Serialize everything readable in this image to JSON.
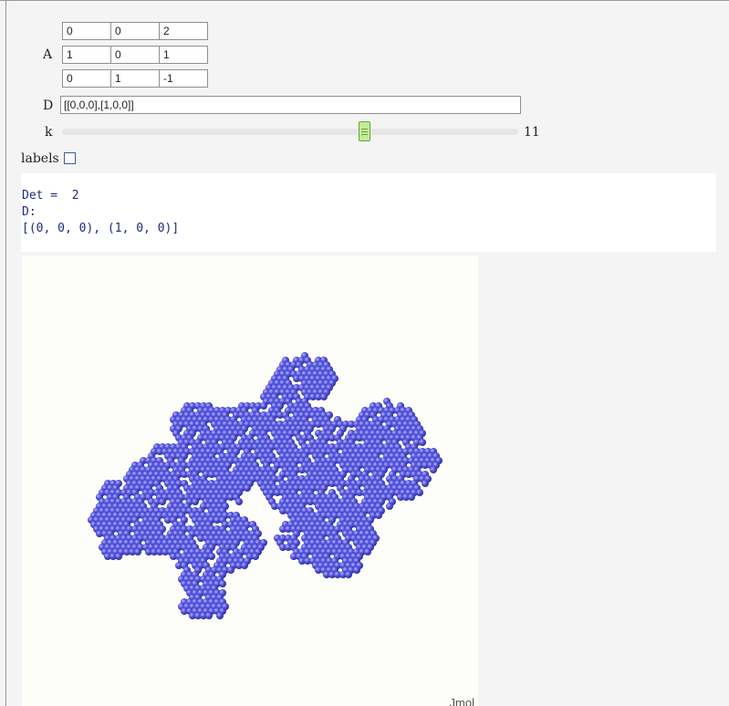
{
  "controls": {
    "matrix_label": "A",
    "matrix": [
      [
        "0",
        "0",
        "2"
      ],
      [
        "1",
        "0",
        "1"
      ],
      [
        "0",
        "1",
        "-1"
      ]
    ],
    "d_label": "D",
    "d_value": "[[0,0,0],[1,0,0]]",
    "k_label": "k",
    "k_value": "11",
    "labels_label": "labels",
    "labels_checked": false
  },
  "output": {
    "det_line": "Det =  2",
    "d_line": "D:",
    "d_list_line": "[(0, 0, 0), (1, 0, 0)]"
  },
  "viewer": {
    "brand": "Jmol",
    "atom_color": "#5454e0"
  }
}
